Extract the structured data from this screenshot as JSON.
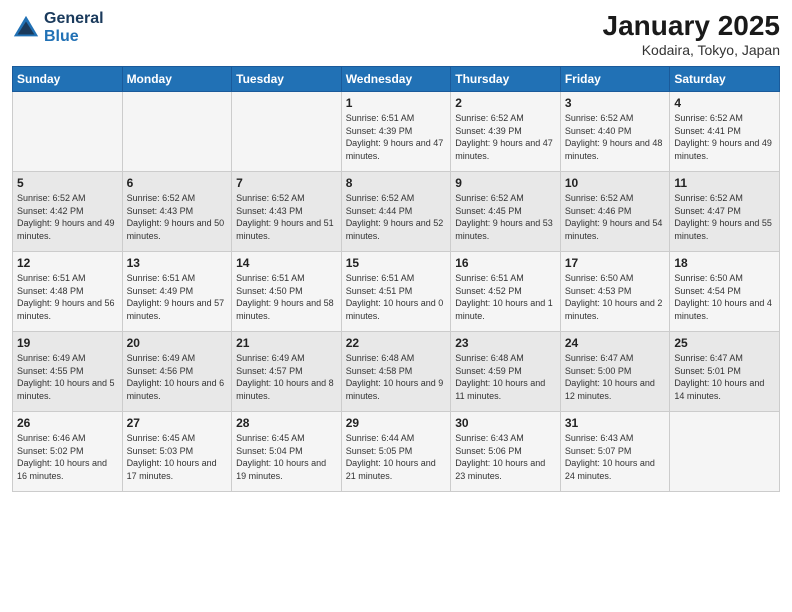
{
  "header": {
    "logo_line1": "General",
    "logo_line2": "Blue",
    "title": "January 2025",
    "subtitle": "Kodaira, Tokyo, Japan"
  },
  "days_of_week": [
    "Sunday",
    "Monday",
    "Tuesday",
    "Wednesday",
    "Thursday",
    "Friday",
    "Saturday"
  ],
  "weeks": [
    [
      {
        "day": "",
        "info": ""
      },
      {
        "day": "",
        "info": ""
      },
      {
        "day": "",
        "info": ""
      },
      {
        "day": "1",
        "info": "Sunrise: 6:51 AM\nSunset: 4:39 PM\nDaylight: 9 hours and 47 minutes."
      },
      {
        "day": "2",
        "info": "Sunrise: 6:52 AM\nSunset: 4:39 PM\nDaylight: 9 hours and 47 minutes."
      },
      {
        "day": "3",
        "info": "Sunrise: 6:52 AM\nSunset: 4:40 PM\nDaylight: 9 hours and 48 minutes."
      },
      {
        "day": "4",
        "info": "Sunrise: 6:52 AM\nSunset: 4:41 PM\nDaylight: 9 hours and 49 minutes."
      }
    ],
    [
      {
        "day": "5",
        "info": "Sunrise: 6:52 AM\nSunset: 4:42 PM\nDaylight: 9 hours and 49 minutes."
      },
      {
        "day": "6",
        "info": "Sunrise: 6:52 AM\nSunset: 4:43 PM\nDaylight: 9 hours and 50 minutes."
      },
      {
        "day": "7",
        "info": "Sunrise: 6:52 AM\nSunset: 4:43 PM\nDaylight: 9 hours and 51 minutes."
      },
      {
        "day": "8",
        "info": "Sunrise: 6:52 AM\nSunset: 4:44 PM\nDaylight: 9 hours and 52 minutes."
      },
      {
        "day": "9",
        "info": "Sunrise: 6:52 AM\nSunset: 4:45 PM\nDaylight: 9 hours and 53 minutes."
      },
      {
        "day": "10",
        "info": "Sunrise: 6:52 AM\nSunset: 4:46 PM\nDaylight: 9 hours and 54 minutes."
      },
      {
        "day": "11",
        "info": "Sunrise: 6:52 AM\nSunset: 4:47 PM\nDaylight: 9 hours and 55 minutes."
      }
    ],
    [
      {
        "day": "12",
        "info": "Sunrise: 6:51 AM\nSunset: 4:48 PM\nDaylight: 9 hours and 56 minutes."
      },
      {
        "day": "13",
        "info": "Sunrise: 6:51 AM\nSunset: 4:49 PM\nDaylight: 9 hours and 57 minutes."
      },
      {
        "day": "14",
        "info": "Sunrise: 6:51 AM\nSunset: 4:50 PM\nDaylight: 9 hours and 58 minutes."
      },
      {
        "day": "15",
        "info": "Sunrise: 6:51 AM\nSunset: 4:51 PM\nDaylight: 10 hours and 0 minutes."
      },
      {
        "day": "16",
        "info": "Sunrise: 6:51 AM\nSunset: 4:52 PM\nDaylight: 10 hours and 1 minute."
      },
      {
        "day": "17",
        "info": "Sunrise: 6:50 AM\nSunset: 4:53 PM\nDaylight: 10 hours and 2 minutes."
      },
      {
        "day": "18",
        "info": "Sunrise: 6:50 AM\nSunset: 4:54 PM\nDaylight: 10 hours and 4 minutes."
      }
    ],
    [
      {
        "day": "19",
        "info": "Sunrise: 6:49 AM\nSunset: 4:55 PM\nDaylight: 10 hours and 5 minutes."
      },
      {
        "day": "20",
        "info": "Sunrise: 6:49 AM\nSunset: 4:56 PM\nDaylight: 10 hours and 6 minutes."
      },
      {
        "day": "21",
        "info": "Sunrise: 6:49 AM\nSunset: 4:57 PM\nDaylight: 10 hours and 8 minutes."
      },
      {
        "day": "22",
        "info": "Sunrise: 6:48 AM\nSunset: 4:58 PM\nDaylight: 10 hours and 9 minutes."
      },
      {
        "day": "23",
        "info": "Sunrise: 6:48 AM\nSunset: 4:59 PM\nDaylight: 10 hours and 11 minutes."
      },
      {
        "day": "24",
        "info": "Sunrise: 6:47 AM\nSunset: 5:00 PM\nDaylight: 10 hours and 12 minutes."
      },
      {
        "day": "25",
        "info": "Sunrise: 6:47 AM\nSunset: 5:01 PM\nDaylight: 10 hours and 14 minutes."
      }
    ],
    [
      {
        "day": "26",
        "info": "Sunrise: 6:46 AM\nSunset: 5:02 PM\nDaylight: 10 hours and 16 minutes."
      },
      {
        "day": "27",
        "info": "Sunrise: 6:45 AM\nSunset: 5:03 PM\nDaylight: 10 hours and 17 minutes."
      },
      {
        "day": "28",
        "info": "Sunrise: 6:45 AM\nSunset: 5:04 PM\nDaylight: 10 hours and 19 minutes."
      },
      {
        "day": "29",
        "info": "Sunrise: 6:44 AM\nSunset: 5:05 PM\nDaylight: 10 hours and 21 minutes."
      },
      {
        "day": "30",
        "info": "Sunrise: 6:43 AM\nSunset: 5:06 PM\nDaylight: 10 hours and 23 minutes."
      },
      {
        "day": "31",
        "info": "Sunrise: 6:43 AM\nSunset: 5:07 PM\nDaylight: 10 hours and 24 minutes."
      },
      {
        "day": "",
        "info": ""
      }
    ]
  ]
}
